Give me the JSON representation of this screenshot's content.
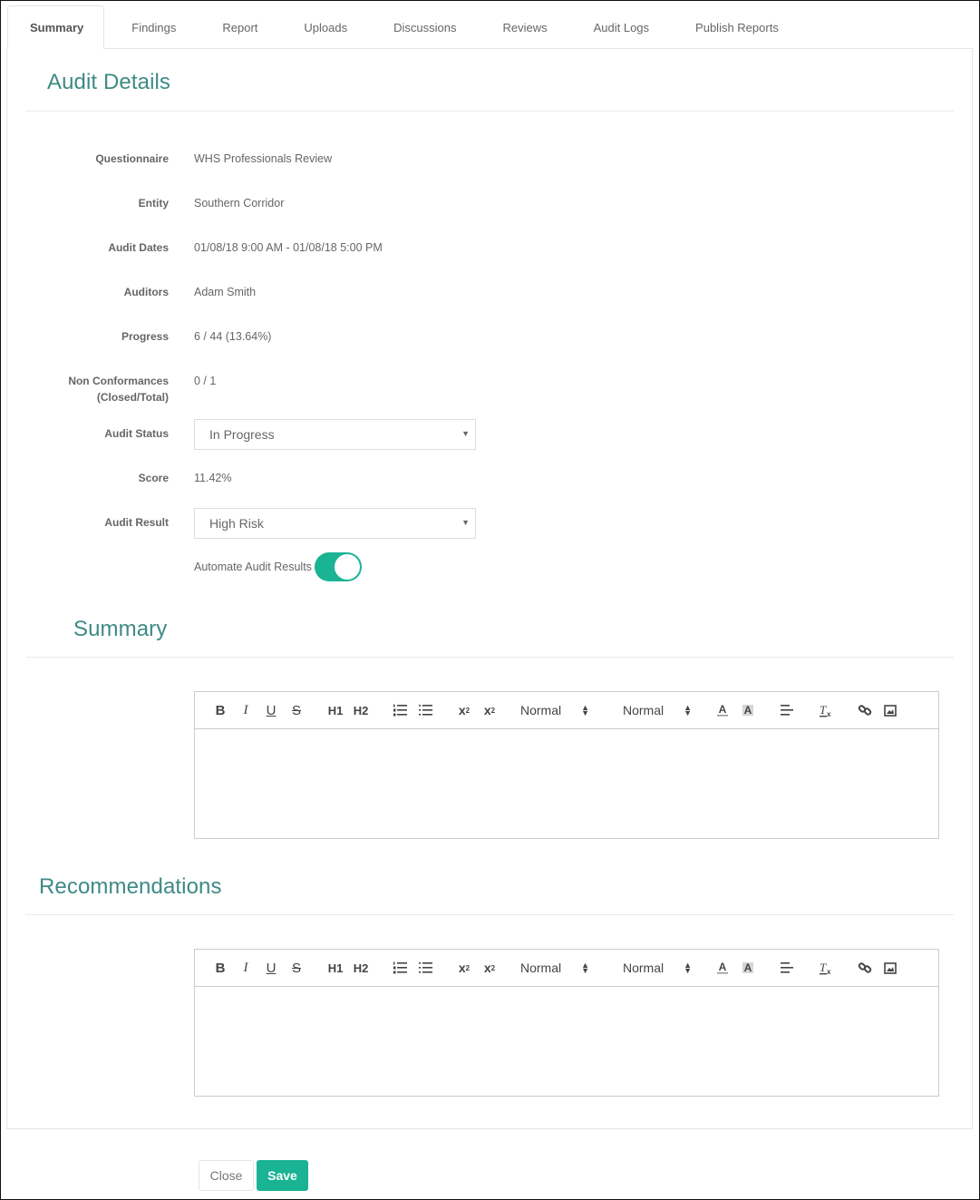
{
  "tabs": [
    {
      "label": "Summary",
      "active": true
    },
    {
      "label": "Findings",
      "active": false
    },
    {
      "label": "Report",
      "active": false
    },
    {
      "label": "Uploads",
      "active": false
    },
    {
      "label": "Discussions",
      "active": false
    },
    {
      "label": "Reviews",
      "active": false
    },
    {
      "label": "Audit Logs",
      "active": false
    },
    {
      "label": "Publish Reports",
      "active": false
    }
  ],
  "audit_details": {
    "title": "Audit Details",
    "fields": {
      "questionnaire": {
        "label": "Questionnaire",
        "value": "WHS Professionals Review"
      },
      "entity": {
        "label": "Entity",
        "value": "Southern Corridor"
      },
      "audit_dates": {
        "label": "Audit Dates",
        "value": "01/08/18 9:00 AM - 01/08/18 5:00 PM"
      },
      "auditors": {
        "label": "Auditors",
        "value": "Adam Smith"
      },
      "progress": {
        "label": "Progress",
        "value": "6 / 44 (13.64%)"
      },
      "non_conformances": {
        "label_line1": "Non Conformances",
        "label_line2": "(Closed/Total)",
        "value": "0 / 1"
      },
      "audit_status": {
        "label": "Audit Status",
        "selected": "In Progress"
      },
      "score": {
        "label": "Score",
        "value": "11.42%"
      },
      "audit_result": {
        "label": "Audit Result",
        "selected": "High Risk"
      }
    },
    "automate_toggle": {
      "label": "Automate Audit Results",
      "on": true
    }
  },
  "summary": {
    "title": "Summary",
    "editor": {
      "header_picker": "Normal",
      "size_picker": "Normal",
      "content": ""
    }
  },
  "recommendations": {
    "title": "Recommendations",
    "editor": {
      "header_picker": "Normal",
      "size_picker": "Normal",
      "content": ""
    }
  },
  "toolbar_glyphs": {
    "bold": "B",
    "italic": "I",
    "underline": "U",
    "strike": "S",
    "h1": "H1",
    "h2": "H2",
    "sub": "x",
    "sup": "x"
  },
  "footer": {
    "close_label": "Close",
    "save_label": "Save"
  },
  "colors": {
    "accent": "#1ab394",
    "heading": "#3e8a85"
  }
}
